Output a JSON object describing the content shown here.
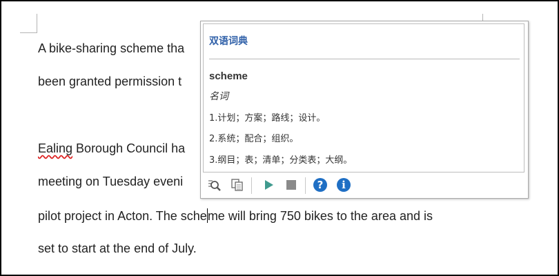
{
  "document": {
    "lines": [
      "A bike-sharing scheme tha",
      "been granted permission t",
      "Ealing Borough Council ha",
      "meeting on Tuesday eveni",
      "pilot project in Acton. The sche",
      "me will bring 750 bikes to the area and is",
      "set to start at the end of July."
    ],
    "misspelled_word": "Ealing"
  },
  "dictionary_popup": {
    "title": "双语词典",
    "headword": "scheme",
    "part_of_speech": "名词",
    "definitions": [
      "1.计划；方案；路线；设计。",
      "2.系统；配合；组织。",
      "3.纲目；表；清单；分类表；大纲。"
    ],
    "toolbar": {
      "icons": [
        "search-icon",
        "copy-icon",
        "play-icon",
        "stop-icon",
        "help-icon",
        "info-icon"
      ],
      "help_glyph": "?",
      "info_glyph": "i",
      "colors": {
        "play": "#3f9a8e",
        "stop": "#8a8a8a",
        "help": "#1f6fc4",
        "info": "#1f6fc4"
      }
    }
  }
}
